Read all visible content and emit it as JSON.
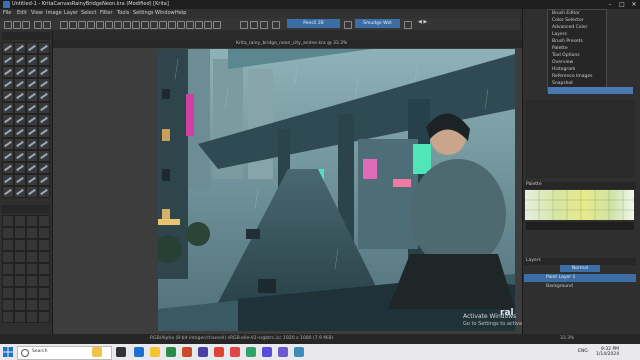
{
  "window": {
    "title": "Untitled-1 - KritaCanvasRainyBridgeNeon.kra (Modified) [Krita]",
    "minimize": "–",
    "maximize": "□",
    "close": "✕"
  },
  "menu": [
    "File",
    "Edit",
    "View",
    "Image",
    "Layer",
    "Select",
    "Filter",
    "Tools",
    "Settings",
    "Window",
    "Help"
  ],
  "toolbar": {
    "tool_field": "Pencil 2B",
    "brush_field": "Smudge Wet",
    "pager": "◀ ▶"
  },
  "document": {
    "tab_label": "Krita_rainy_bridge_neon_city_anime.kra @ 33.3%"
  },
  "watermark": {
    "logo": "ral",
    "activate_title": "Activate Windows",
    "activate_sub": "Go to Settings to activate Windows."
  },
  "popup_menu": [
    "Brush Editor",
    "Color Selector",
    "Advanced Color",
    "Layers",
    "Brush Presets",
    "Palette",
    "Tool Options",
    "Overview",
    "Histogram",
    "Reference Images",
    "Snapshot"
  ],
  "palette": {
    "title": "Palette"
  },
  "layers": {
    "title": "Layers",
    "blend_mode": "Normal",
    "rows": [
      "Paint Layer 1",
      "Background"
    ]
  },
  "status": {
    "text": "RGB/Alpha (8-bit integer/channel)  sRGB-elle-V2-srgbtrc.icc   1920 x 1080 (7.9 MiB)",
    "zoom": "33.3%"
  },
  "taskbar": {
    "search": "Search",
    "lang": "ENG",
    "time": "9:32 PM",
    "date": "1/14/2024"
  },
  "colors": {
    "accent": "#3a6ea5",
    "taskbar": "#e9e9ed"
  }
}
